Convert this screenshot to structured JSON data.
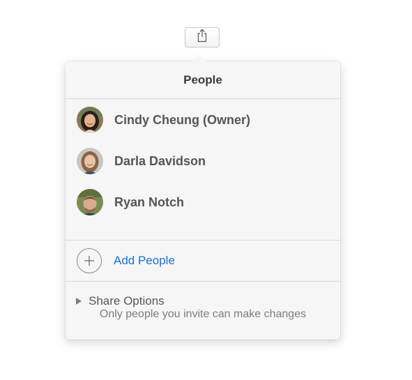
{
  "share_button": {
    "icon": "share-icon"
  },
  "popover": {
    "title": "People",
    "people": [
      {
        "name": "Cindy Cheung (Owner)",
        "avatar": "avatar-cindy"
      },
      {
        "name": "Darla Davidson",
        "avatar": "avatar-darla"
      },
      {
        "name": "Ryan Notch",
        "avatar": "avatar-ryan"
      }
    ],
    "add_people": {
      "label": "Add People",
      "icon": "plus-circle-icon",
      "color": "#1a6fc4"
    },
    "share_options": {
      "label": "Share Options",
      "icon": "disclosure-triangle-icon"
    },
    "footnote": "Only people you invite can make changes"
  }
}
